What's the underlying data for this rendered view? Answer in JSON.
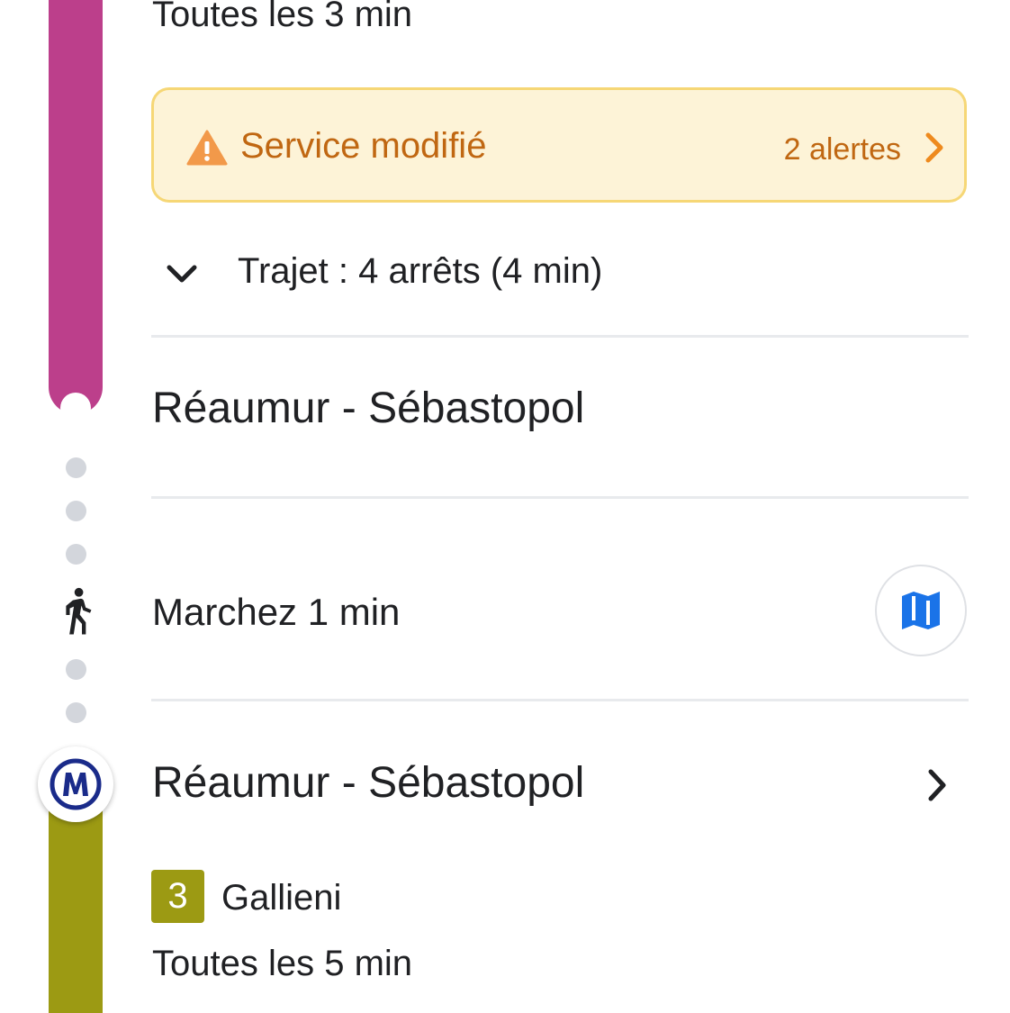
{
  "segment_top": {
    "frequency": "Toutes les 3 min",
    "line_color": "#bc3f8b"
  },
  "alert": {
    "title": "Service modifié",
    "count": "2 alertes",
    "icon": "warning-icon",
    "accent_color": "#c06712"
  },
  "trajet": {
    "label": "Trajet : 4 arrêts (4 min)",
    "icon": "chevron-down-icon"
  },
  "arrival_stop": {
    "name": "Réaumur - Sébastopol"
  },
  "walk": {
    "label": "Marchez 1 min",
    "icon": "walk-icon",
    "map_icon": "map-icon"
  },
  "departure_stop": {
    "name": "Réaumur - Sébastopol",
    "icon": "metro-icon"
  },
  "segment_bottom": {
    "line_number": "3",
    "direction": "Gallieni",
    "frequency": "Toutes les 5 min",
    "line_color": "#9c9a13"
  }
}
